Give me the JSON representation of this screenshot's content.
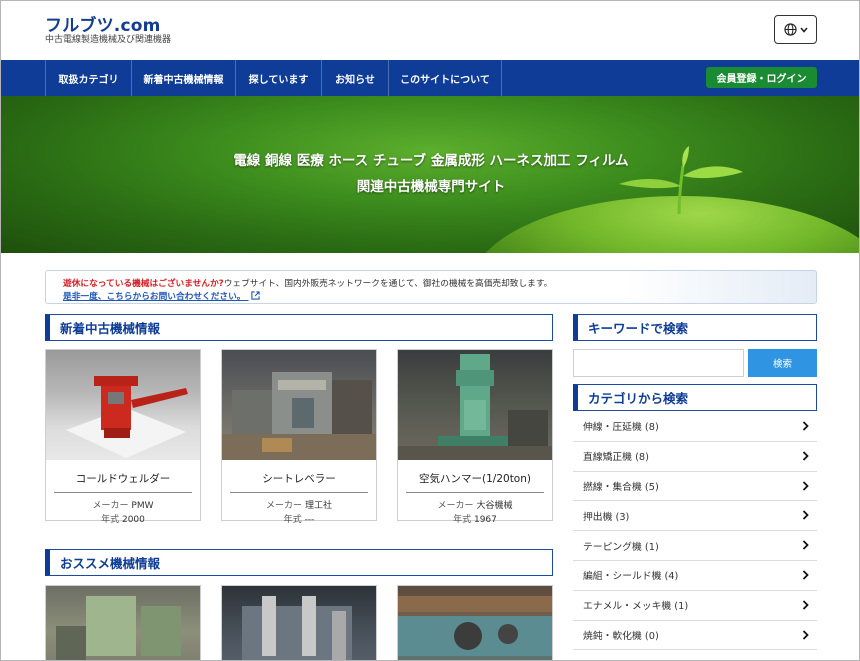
{
  "header": {
    "logo": "フルブツ.com",
    "tagline": "中古電線製造機械及び関連機器",
    "language_icon": "globe-icon"
  },
  "nav": {
    "items": [
      {
        "label": "取扱カテゴリ"
      },
      {
        "label": "新着中古機械情報"
      },
      {
        "label": "探しています"
      },
      {
        "label": "お知らせ"
      },
      {
        "label": "このサイトについて"
      }
    ],
    "login_label": "会員登録・ログイン"
  },
  "hero": {
    "line1": "電線 銅線 医療 ホース チューブ 金属成形 ハーネス加工 フィルム",
    "line2": "関連中古機械専門サイト"
  },
  "notice": {
    "highlight": "遊休になっている機械はございませんか?",
    "text": "ウェブサイト、国内外販売ネットワークを通じて、御社の機械を高価売却致します。",
    "link": "是非一度、こちらからお問い合わせください。"
  },
  "new_section": {
    "title": "新着中古機械情報",
    "maker_label": "メーカー",
    "year_label": "年式",
    "cards": [
      {
        "name": "コールドウェルダー",
        "maker": "PMW",
        "year": "2000"
      },
      {
        "name": "シートレベラー",
        "maker": "理工社",
        "year": "---"
      },
      {
        "name": "空気ハンマー(1/20ton)",
        "maker": "大谷機械",
        "year": "1967"
      }
    ]
  },
  "recommended_section": {
    "title": "おススメ機械情報"
  },
  "keyword_search": {
    "title": "キーワードで検索",
    "input_value": "",
    "button_label": "検索"
  },
  "category_search": {
    "title": "カテゴリから検索",
    "items": [
      {
        "label": "伸線・圧延機 (8)"
      },
      {
        "label": "直線矯正機 (8)"
      },
      {
        "label": "撚線・集合機 (5)"
      },
      {
        "label": "押出機 (3)"
      },
      {
        "label": "テーピング機 (1)"
      },
      {
        "label": "編組・シールド機 (4)"
      },
      {
        "label": "エナメル・メッキ機 (1)"
      },
      {
        "label": "焼鈍・軟化機 (0)"
      }
    ]
  },
  "colors": {
    "brand_blue": "#0f3c97",
    "login_green": "#1a8a33",
    "search_blue": "#2f94e2",
    "notice_red": "#d61f26"
  }
}
